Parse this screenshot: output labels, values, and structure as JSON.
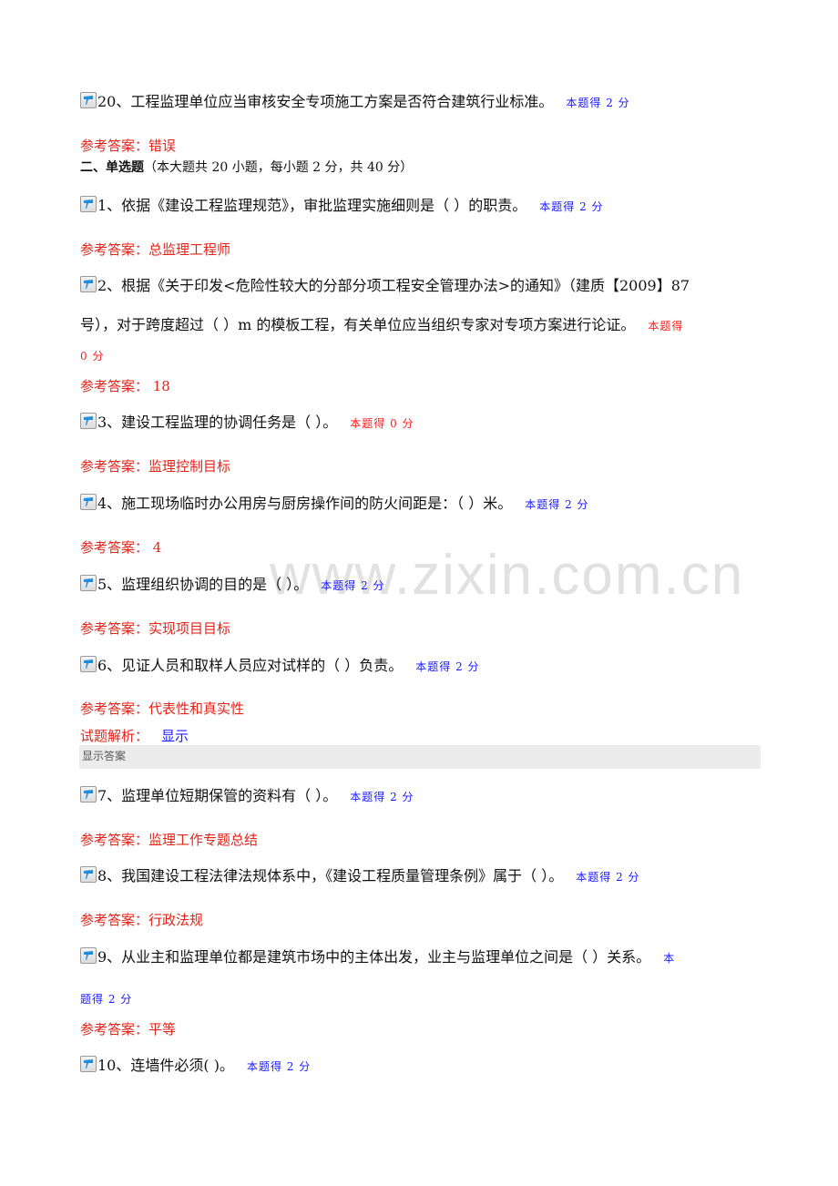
{
  "watermark": "www.zixin.com.cn",
  "colors": {
    "score_full": "#1a1aff",
    "score_zero": "#ff1a1a",
    "answer": "#e2241b",
    "link": "#1a1aff"
  },
  "icon": "flag-icon",
  "prev_question": {
    "text": "20、工程监理单位应当审核安全专项施工方案是否符合建筑行业标准。",
    "score": "本题得 2 分",
    "answer": "参考答案：错误"
  },
  "section": {
    "title": "二、单选题",
    "info": "（本大题共 20 小题，每小题 2 分，共 40 分）"
  },
  "questions": [
    {
      "text": "1、依据《建设工程监理规范》，审批监理实施细则是（ ）的职责。",
      "score": "本题得 2 分",
      "answer": "参考答案：总监理工程师"
    },
    {
      "text_line1": "2、根据《关于印发<危险性较大的分部分项工程安全管理办法>的通知》（建质【2009】87",
      "text_line2": "号），对于跨度超过（ ）m 的模板工程，有关单位应当组织专家对专项方案进行论证。",
      "score_part1": "本题得",
      "score_part2": "0 分",
      "answer": "参考答案： 18"
    },
    {
      "text": "3、建设工程监理的协调任务是（ ）。",
      "score": "本题得 0 分",
      "answer": "参考答案：监理控制目标"
    },
    {
      "text": "4、施工现场临时办公用房与厨房操作间的防火间距是：（ ）米。",
      "score": "本题得 2 分",
      "answer": "参考答案： 4"
    },
    {
      "text": "5、监理组织协调的目的是（ ）。",
      "score": "本题得 2 分",
      "answer": "参考答案：实现项目目标"
    },
    {
      "text": "6、见证人员和取样人员应对试样的（ ）负责。",
      "score": "本题得 2 分",
      "answer": "参考答案：代表性和真实性",
      "analysis_label": "试题解析：",
      "analysis_link": "显示",
      "show_answer": "显示答案"
    },
    {
      "text": "7、监理单位短期保管的资料有（ ）。",
      "score": "本题得 2 分",
      "answer": "参考答案：监理工作专题总结"
    },
    {
      "text": "8、我国建设工程法律法规体系中，《建设工程质量管理条例》属于（ ）。",
      "score": "本题得 2 分",
      "answer": "参考答案：行政法规"
    },
    {
      "text": "9、从业主和监理单位都是建筑市场中的主体出发，业主与监理单位之间是（ ）关系。",
      "score_part1": "本",
      "score_part2": "题得 2 分",
      "answer": "参考答案：平等"
    },
    {
      "text": "10、连墙件必须( )。",
      "score": "本题得 2 分"
    }
  ]
}
